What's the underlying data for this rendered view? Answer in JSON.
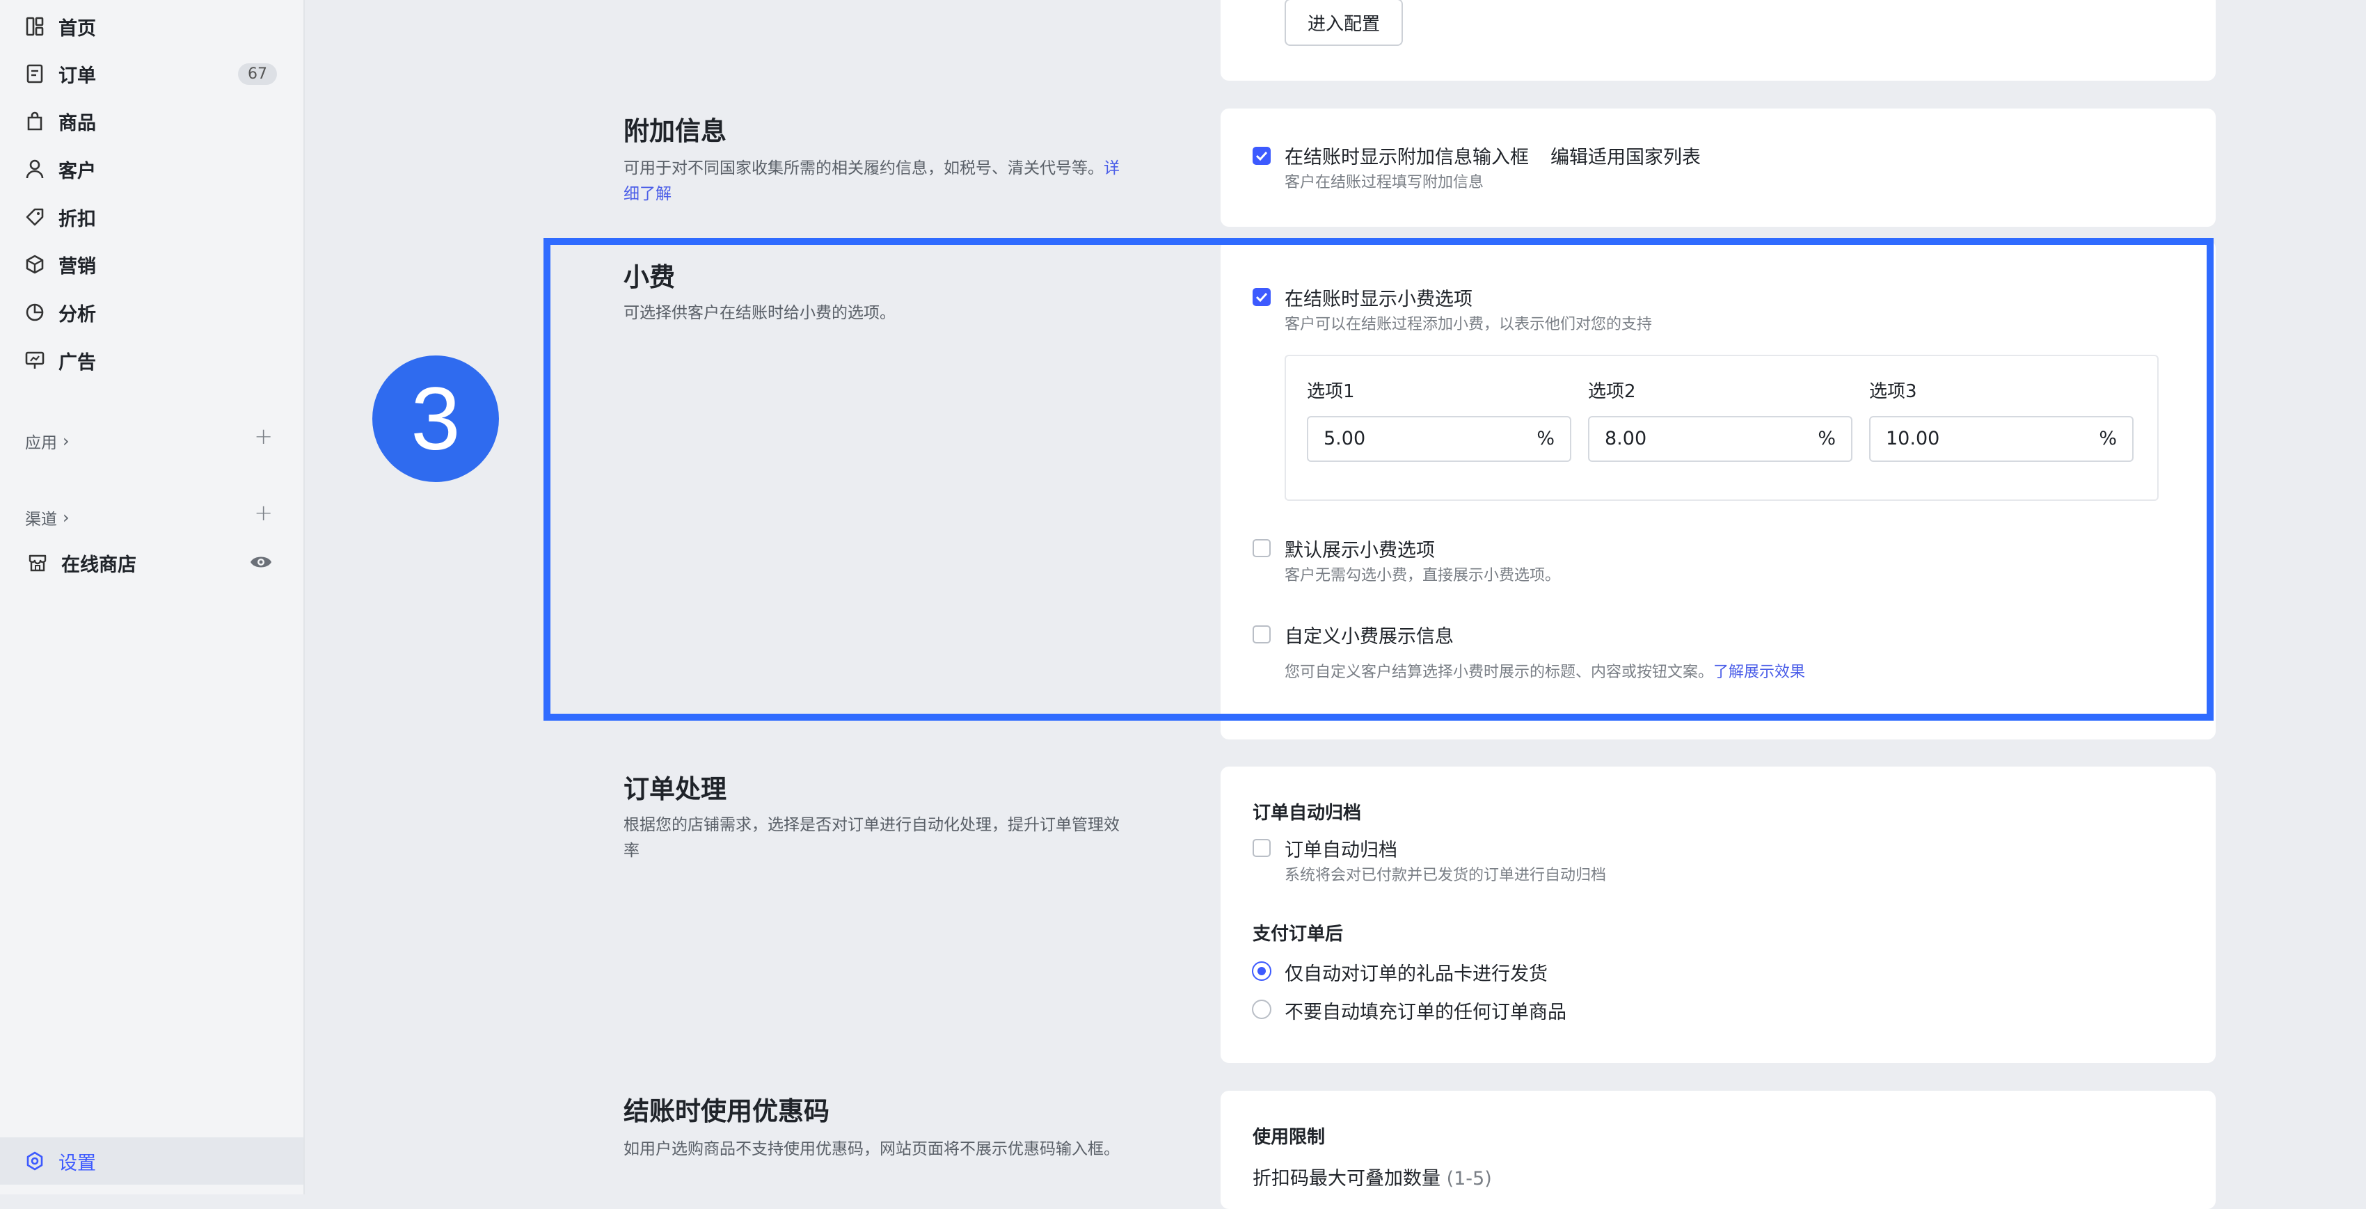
{
  "sidebar": {
    "items": [
      {
        "label": "首页",
        "icon": "dashboard-icon"
      },
      {
        "label": "订单",
        "icon": "order-icon",
        "badge": "67"
      },
      {
        "label": "商品",
        "icon": "bag-icon"
      },
      {
        "label": "客户",
        "icon": "user-icon"
      },
      {
        "label": "折扣",
        "icon": "tag-icon"
      },
      {
        "label": "营销",
        "icon": "box-icon"
      },
      {
        "label": "分析",
        "icon": "pie-chart-icon"
      },
      {
        "label": "广告",
        "icon": "billboard-icon"
      }
    ],
    "apps_label": "应用",
    "channels_label": "渠道",
    "online_store_label": "在线商店",
    "settings_label": "设置"
  },
  "top_card": {
    "button_label": "进入配置"
  },
  "additional_info": {
    "title": "附加信息",
    "desc": "可用于对不同国家收集所需的相关履约信息，如税号、清关代号等。",
    "desc_link": "详细了解",
    "checkbox_label": "在结账时显示附加信息输入框",
    "edit_link": "编辑适用国家列表",
    "sub": "客户在结账过程填写附加信息"
  },
  "tips": {
    "step_number": "3",
    "title": "小费",
    "desc": "可选择供客户在结账时给小费的选项。",
    "show_label": "在结账时显示小费选项",
    "show_sub": "客户可以在结账过程添加小费，以表示他们对您的支持",
    "options": [
      {
        "label": "选项1",
        "value": "5.00",
        "unit": "%"
      },
      {
        "label": "选项2",
        "value": "8.00",
        "unit": "%"
      },
      {
        "label": "选项3",
        "value": "10.00",
        "unit": "%"
      }
    ],
    "default_label": "默认展示小费选项",
    "default_sub": "客户无需勾选小费，直接展示小费选项。",
    "custom_label": "自定义小费展示信息",
    "custom_sub": "您可自定义客户结算选择小费时展示的标题、内容或按钮文案。",
    "custom_link": "了解展示效果"
  },
  "order_processing": {
    "title": "订单处理",
    "desc": "根据您的店铺需求，选择是否对订单进行自动化处理，提升订单管理效率",
    "archive_heading": "订单自动归档",
    "archive_label": "订单自动归档",
    "archive_sub": "系统将会对已付款并已发货的订单进行自动归档",
    "after_pay_heading": "支付订单后",
    "radio1": "仅自动对订单的礼品卡进行发货",
    "radio2": "不要自动填充订单的任何订单商品"
  },
  "coupon": {
    "title": "结账时使用优惠码",
    "desc": "如用户选购商品不支持使用优惠码，网站页面将不展示优惠码输入框。",
    "limit_heading": "使用限制",
    "stack_label": "折扣码最大可叠加数量",
    "stack_range": "(1-5)"
  }
}
